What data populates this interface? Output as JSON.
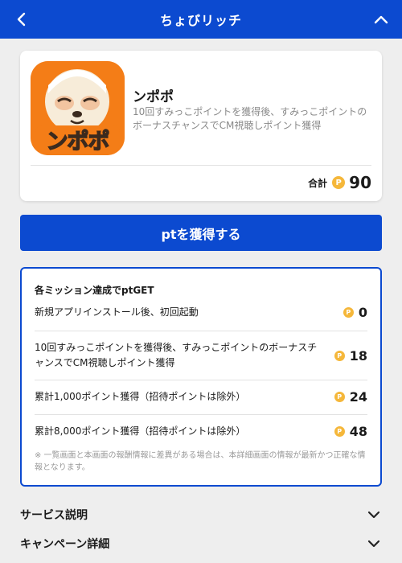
{
  "header": {
    "title": "ちょびリッチ",
    "back_icon": "chevron-left-icon",
    "collapse_icon": "chevron-up-icon"
  },
  "app": {
    "name": "ンポポ",
    "description": "10回すみっこポイントを獲得後、すみっこポイントのボーナスチャンスでCM視聴しポイント獲得",
    "icon_text": "ンポポ",
    "total_label": "合計",
    "total_value": "90",
    "coin_symbol": "P"
  },
  "get_button": {
    "label": "ptを獲得する"
  },
  "missions": {
    "title": "各ミッション達成でptGET",
    "items": [
      {
        "label": "新規アプリインストール後、初回起動",
        "value": "0"
      },
      {
        "label": "10回すみっこポイントを獲得後、すみっこポイントのボーナスチャンスでCM視聴しポイント獲得",
        "value": "18"
      },
      {
        "label": "累計1,000ポイント獲得（招待ポイントは除外）",
        "value": "24"
      },
      {
        "label": "累計8,000ポイント獲得（招待ポイントは除外）",
        "value": "48"
      }
    ],
    "note": "※ 一覧画面と本画面の報酬情報に差異がある場合は、本詳細画面の情報が最新かつ正確な情報となります。"
  },
  "sections": [
    {
      "label": "サービス説明"
    },
    {
      "label": "キャンペーン詳細"
    }
  ],
  "colors": {
    "primary": "#0c4ad0",
    "coin": "#f5b73a",
    "icon_bg": "#f47d17"
  }
}
